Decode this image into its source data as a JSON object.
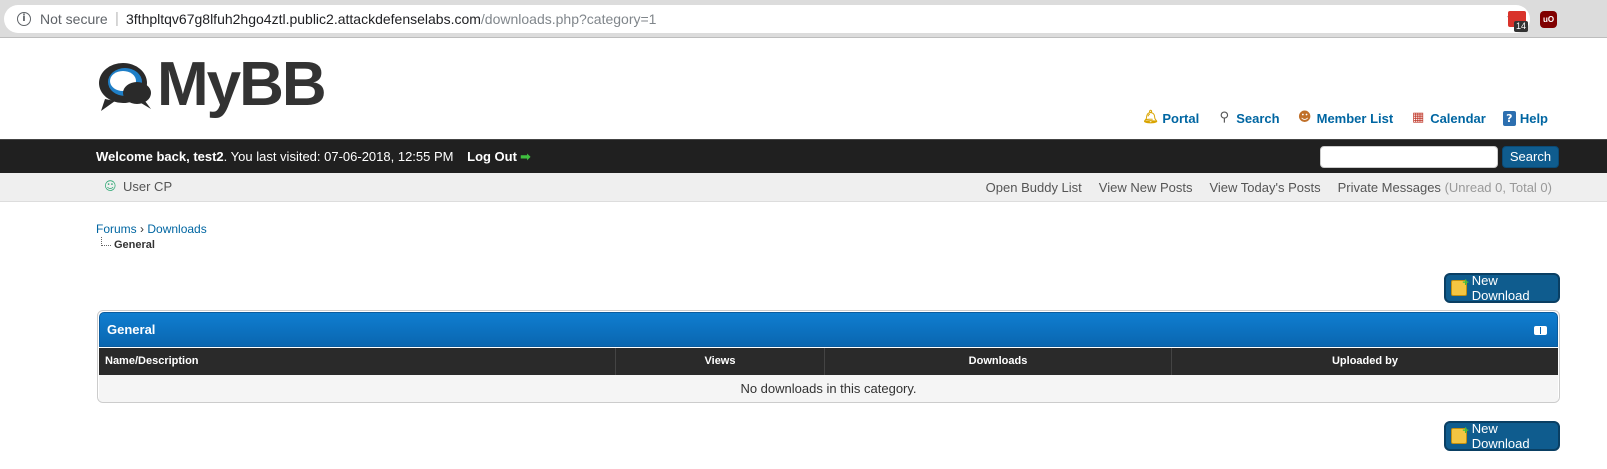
{
  "browser": {
    "security_label": "Not secure",
    "url_host": "3fthpltqv67g8lfuh2hgo4ztl.public2.attackdefenselabs.com",
    "url_path": "/downloads.php?category=1",
    "extension_badge": "14",
    "extension2_label": "uO"
  },
  "header": {
    "logo_text": "MyBB",
    "links": [
      {
        "label": "Portal",
        "icon": "bell-icon"
      },
      {
        "label": "Search",
        "icon": "search-icon"
      },
      {
        "label": "Member List",
        "icon": "members-icon"
      },
      {
        "label": "Calendar",
        "icon": "calendar-icon"
      },
      {
        "label": "Help",
        "icon": "help-icon"
      }
    ]
  },
  "welcome": {
    "prefix": "Welcome back, ",
    "username": "test2",
    "last_visit": ". You last visited: 07-06-2018, 12:55 PM",
    "logout_label": "Log Out",
    "search_button": "Search"
  },
  "usercp": {
    "label": "User CP",
    "links": [
      "Open Buddy List",
      "View New Posts",
      "View Today's Posts"
    ],
    "pm_label": "Private Messages",
    "pm_counts": "(Unread 0, Total 0)"
  },
  "breadcrumb": {
    "forums": "Forums",
    "separator": "›",
    "downloads": "Downloads",
    "active": "General"
  },
  "new_download_label": "New Download",
  "table": {
    "title": "General",
    "columns": [
      "Name/Description",
      "Views",
      "Downloads",
      "Uploaded by"
    ],
    "empty_message": "No downloads in this category."
  },
  "colors": {
    "link": "#0066a2",
    "header_blue": "#0a66b0",
    "dark_bar": "#202020",
    "button": "#0f5c8e"
  }
}
